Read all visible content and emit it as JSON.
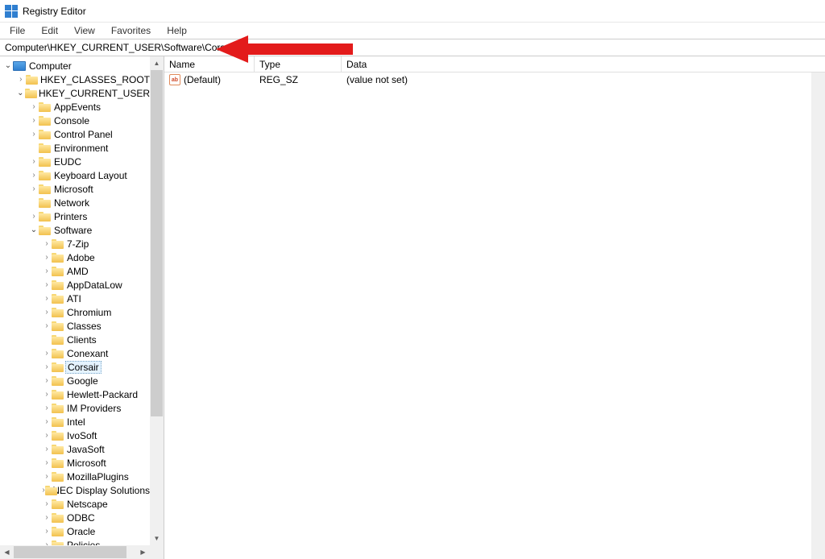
{
  "window": {
    "title": "Registry Editor"
  },
  "menu": {
    "file": "File",
    "edit": "Edit",
    "view": "View",
    "favorites": "Favorites",
    "help": "Help"
  },
  "address": "Computer\\HKEY_CURRENT_USER\\Software\\Corsair",
  "tree": {
    "root": "Computer",
    "hkcr": "HKEY_CLASSES_ROOT",
    "hkcu": "HKEY_CURRENT_USER",
    "hkcu_children": [
      "AppEvents",
      "Console",
      "Control Panel",
      "Environment",
      "EUDC",
      "Keyboard Layout",
      "Microsoft",
      "Network",
      "Printers",
      "Software"
    ],
    "software_children": [
      "7-Zip",
      "Adobe",
      "AMD",
      "AppDataLow",
      "ATI",
      "Chromium",
      "Classes",
      "Clients",
      "Conexant",
      "Corsair",
      "Google",
      "Hewlett-Packard",
      "IM Providers",
      "Intel",
      "IvoSoft",
      "JavaSoft",
      "Microsoft",
      "MozillaPlugins",
      "NEC Display Solutions",
      "Netscape",
      "ODBC",
      "Oracle",
      "Policies"
    ],
    "selected": "Corsair"
  },
  "values": {
    "columns": {
      "name": "Name",
      "type": "Type",
      "data": "Data"
    },
    "rows": [
      {
        "name": "(Default)",
        "type": "REG_SZ",
        "data": "(value not set)"
      }
    ]
  },
  "tree_meta": {
    "hkcu_no_expander": [
      "Environment",
      "Network"
    ],
    "software_no_expander": [
      "Clients"
    ]
  }
}
